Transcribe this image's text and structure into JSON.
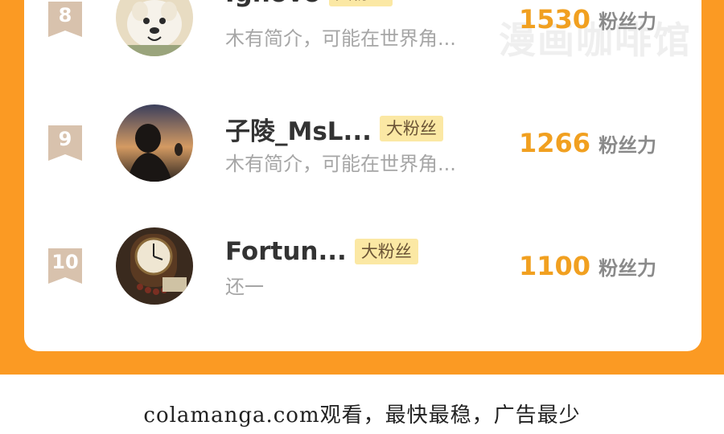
{
  "watermark": "漫画咖啡馆",
  "fan_unit": "粉丝力",
  "rows": [
    {
      "rank": "8",
      "name": "Ignovo",
      "badge": "大粉丝",
      "bio": "木有简介，可能在世界角...",
      "score": "1530",
      "avatar": "dog-avatar"
    },
    {
      "rank": "9",
      "name": "子陵_MsL...",
      "badge": "大粉丝",
      "bio": "木有简介，可能在世界角...",
      "score": "1266",
      "avatar": "silhouette-avatar"
    },
    {
      "rank": "10",
      "name": "Fortun...",
      "badge": "大粉丝",
      "bio": "还一",
      "score": "1100",
      "avatar": "clock-avatar"
    }
  ],
  "footer": "colamanga.com观看，最快最稳，广告最少",
  "colors": {
    "frame": "#fb9a23",
    "score": "#f1a020",
    "badge_bg": "#fbe8a4",
    "rank_tag": "#d8c2ad"
  }
}
